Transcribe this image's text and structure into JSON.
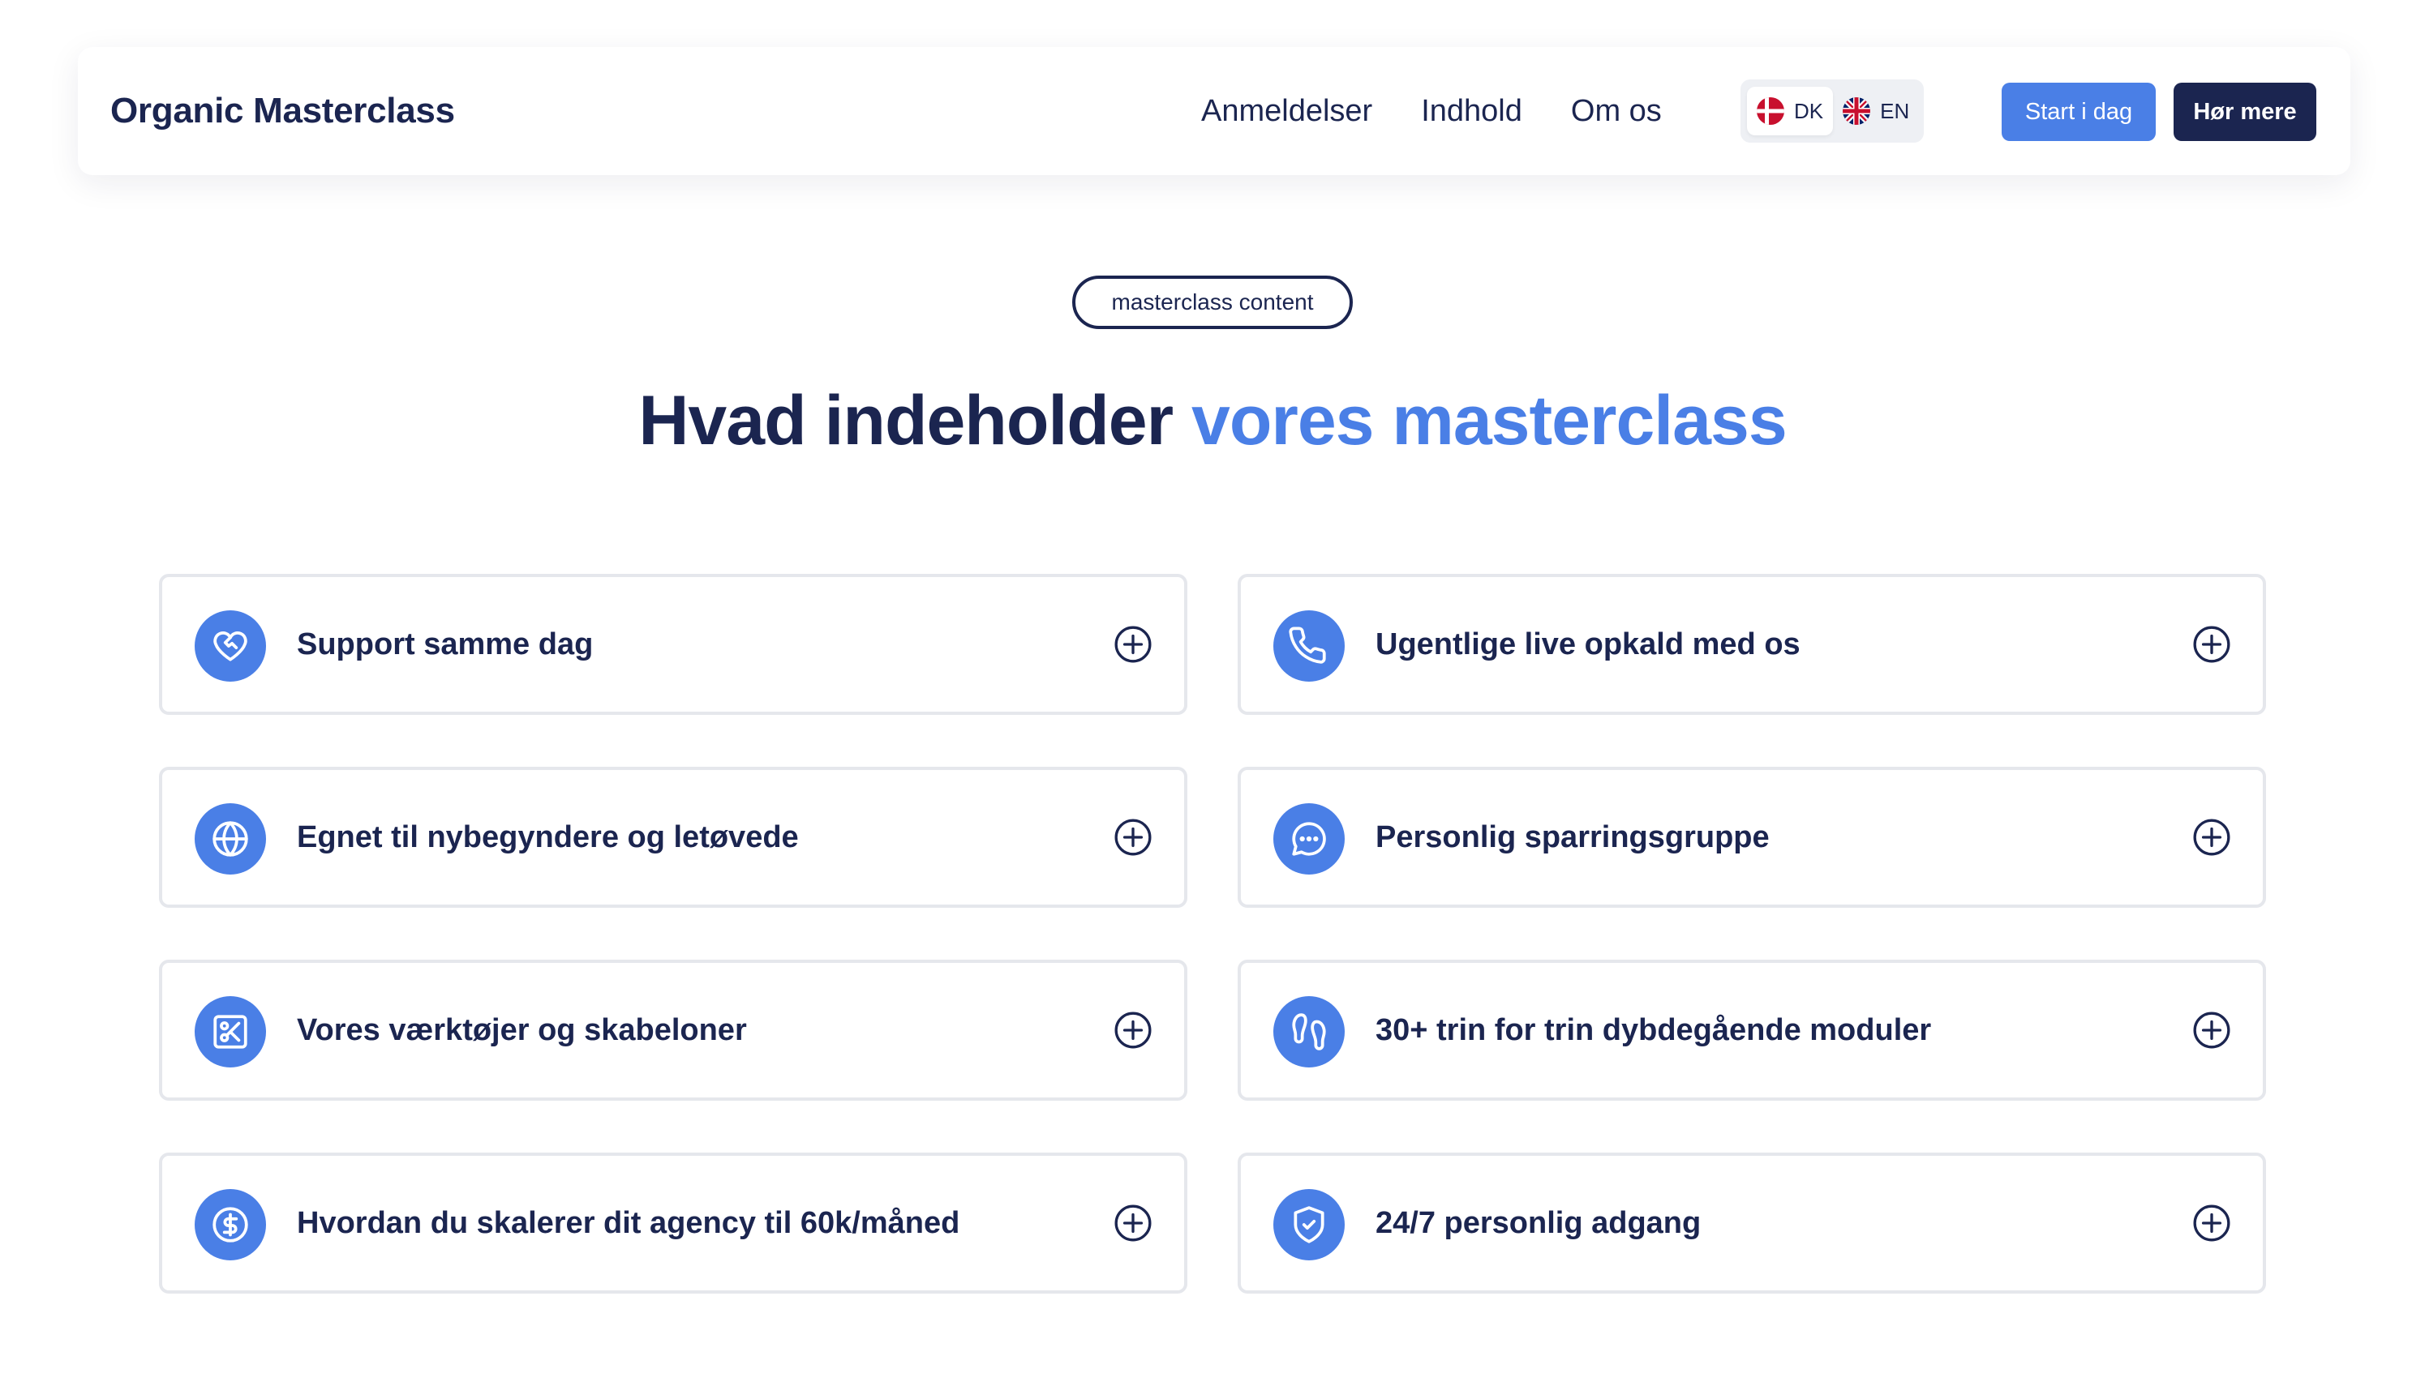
{
  "header": {
    "brand": "Organic Masterclass",
    "nav": [
      "Anmeldelser",
      "Indhold",
      "Om os"
    ],
    "languages": [
      {
        "code": "DK",
        "flag": "denmark-flag-icon",
        "active": true
      },
      {
        "code": "EN",
        "flag": "uk-flag-icon",
        "active": false
      }
    ],
    "primary_button": "Start i dag",
    "secondary_button": "Hør mere"
  },
  "section": {
    "pill": "masterclass content",
    "heading_main": "Hvad indeholder",
    "heading_accent": "vores masterclass"
  },
  "features": [
    {
      "label": "Support samme dag",
      "icon": "heart-handshake-icon"
    },
    {
      "label": "Ugentlige live opkald med os",
      "icon": "phone-icon"
    },
    {
      "label": "Egnet til nybegyndere og letøvede",
      "icon": "globe-icon"
    },
    {
      "label": "Personlig sparringsgruppe",
      "icon": "chat-bubble-icon"
    },
    {
      "label": "Vores værktøjer og skabeloner",
      "icon": "scissors-square-icon"
    },
    {
      "label": "30+ trin for trin dybdegående moduler",
      "icon": "footprints-icon"
    },
    {
      "label": "Hvordan du skalerer dit agency til 60k/måned",
      "icon": "dollar-circle-icon"
    },
    {
      "label": "24/7 personlig adgang",
      "icon": "shield-check-icon"
    }
  ],
  "colors": {
    "navy": "#1b2550",
    "accent": "#4a7fe6",
    "card_border": "#e5e7ec"
  }
}
